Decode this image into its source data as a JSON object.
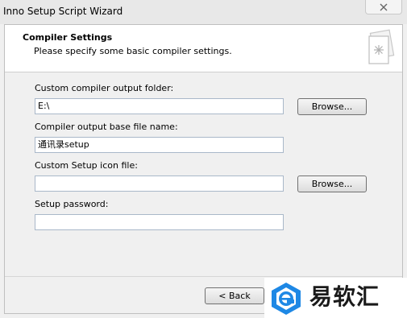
{
  "window": {
    "title": "Inno Setup Script Wizard",
    "close_icon": "close-icon"
  },
  "header": {
    "title": "Compiler Settings",
    "subtitle": "Please specify some basic compiler settings.",
    "icon": "wizard-page-icon"
  },
  "form": {
    "output_folder": {
      "label": "Custom compiler output folder:",
      "value": "E:\\",
      "browse_label": "Browse..."
    },
    "base_file_name": {
      "label": "Compiler output base file name:",
      "value": "通讯录setup"
    },
    "setup_icon": {
      "label": "Custom Setup icon file:",
      "value": "",
      "browse_label": "Browse..."
    },
    "password": {
      "label": "Setup password:",
      "value": ""
    }
  },
  "footer": {
    "back_label": "< Back"
  },
  "watermark": {
    "text": "易软汇",
    "logo_icon": "e-logo-icon"
  },
  "colors": {
    "accent": "#1e88e5",
    "background": "#f0f0f0",
    "header_bg": "#ffffff"
  }
}
